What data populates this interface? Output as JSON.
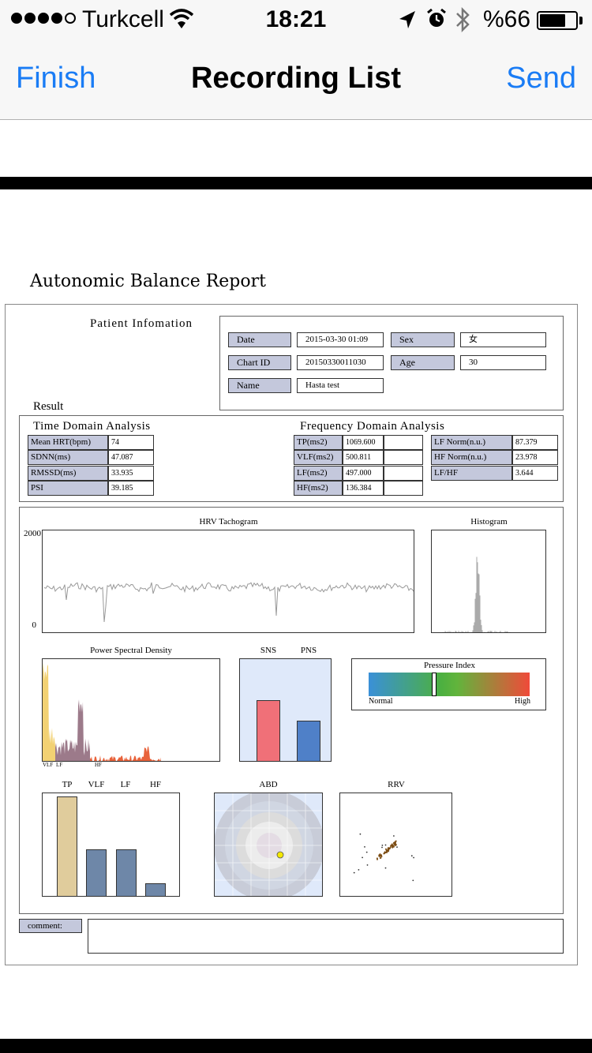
{
  "status_bar": {
    "carrier": "Turkcell",
    "time": "18:21",
    "battery": "%66",
    "battery_level": 0.66
  },
  "nav": {
    "left": "Finish",
    "title": "Recording List",
    "right": "Send"
  },
  "report": {
    "title": "Autonomic Balance Report",
    "patient_title": "Patient Infomation",
    "patient": {
      "date_label": "Date",
      "date": "2015-03-30 01:09",
      "sex_label": "Sex",
      "sex": "女",
      "chart_id_label": "Chart ID",
      "chart_id": "20150330011030",
      "age_label": "Age",
      "age": "30",
      "name_label": "Name",
      "name": "Hasta test"
    },
    "result_title": "Result",
    "time_domain": {
      "title": "Time Domain Analysis",
      "rows": [
        {
          "label": "Mean HRT(bpm)",
          "value": "74"
        },
        {
          "label": "SDNN(ms)",
          "value": "47.087"
        },
        {
          "label": "RMSSD(ms)",
          "value": "33.935"
        },
        {
          "label": "PSI",
          "value": "39.185"
        }
      ]
    },
    "freq_domain": {
      "title": "Frequency Domain Analysis",
      "rows": [
        {
          "label": "TP(ms2)",
          "value": "1069.600",
          "extra": ""
        },
        {
          "label": "VLF(ms2)",
          "value": "500.811",
          "extra": ""
        },
        {
          "label": "LF(ms2)",
          "value": "497.000",
          "extra": ""
        },
        {
          "label": "HF(ms2)",
          "value": "136.384",
          "extra": ""
        }
      ],
      "norm_rows": [
        {
          "label": "LF Norm(n.u.)",
          "value": "87.379"
        },
        {
          "label": "HF Norm(n.u.)",
          "value": "23.978"
        },
        {
          "label": "LF/HF",
          "value": "3.644"
        }
      ]
    },
    "charts": {
      "tachogram_title": "HRV Tachogram",
      "tachogram_ymax": "2000",
      "tachogram_ymin": "0",
      "histogram_title": "Histogram",
      "psd_title": "Power Spectral Density",
      "psd_labels": {
        "vlf": "VLF",
        "lf": "LF",
        "hf": "HF"
      },
      "sns_label": "SNS",
      "pns_label": "PNS",
      "pressure_title": "Pressure Index",
      "pressure_low": "Normal",
      "pressure_high": "High",
      "bars_labels": {
        "tp": "TP",
        "vlf": "VLF",
        "lf": "LF",
        "hf": "HF"
      },
      "abd_title": "ABD",
      "rrv_title": "RRV"
    },
    "comment_label": "comment:",
    "comment_value": ""
  },
  "colors": {
    "ios_blue": "#1a7cf5",
    "label_fill": "#c4c8dc",
    "sns": "#f07078",
    "pns": "#4f80c8",
    "tp_bar": "#e0cc9c",
    "band_bar": "#6e87a8"
  }
}
